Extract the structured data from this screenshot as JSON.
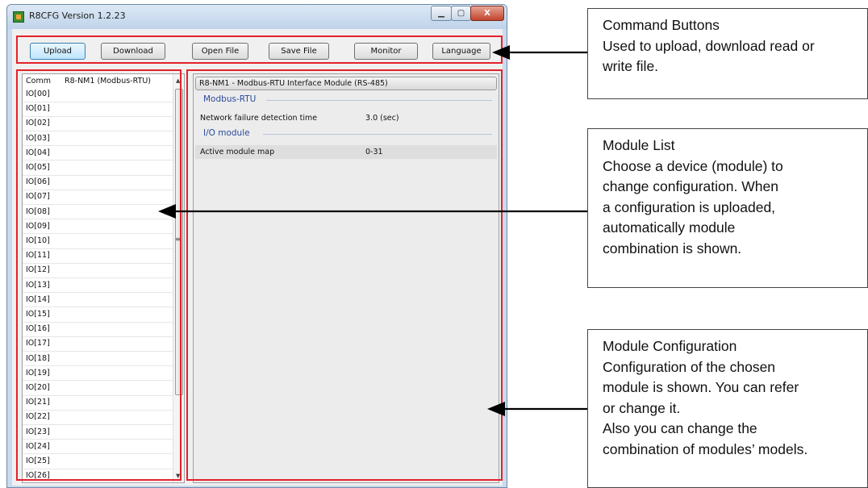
{
  "window": {
    "title": "R8CFG Version 1.2.23",
    "min_glyph": "▁",
    "max_glyph": "▢",
    "close_glyph": "X"
  },
  "toolbar": {
    "upload": "Upload",
    "download": "Download",
    "open_file": "Open File",
    "save_file": "Save File",
    "monitor": "Monitor",
    "language": "Language"
  },
  "module_list": {
    "head_slot": "Comm",
    "head_module": "R8-NM1 (Modbus-RTU)",
    "rows": [
      "IO[00]",
      "IO[01]",
      "IO[02]",
      "IO[03]",
      "IO[04]",
      "IO[05]",
      "IO[06]",
      "IO[07]",
      "IO[08]",
      "IO[09]",
      "IO[10]",
      "IO[11]",
      "IO[12]",
      "IO[13]",
      "IO[14]",
      "IO[15]",
      "IO[16]",
      "IO[17]",
      "IO[18]",
      "IO[19]",
      "IO[20]",
      "IO[21]",
      "IO[22]",
      "IO[23]",
      "IO[24]",
      "IO[25]",
      "IO[26]"
    ]
  },
  "config": {
    "header": "R8-NM1 - Modbus-RTU Interface Module (RS-485)",
    "group1": "Modbus-RTU",
    "prop1_name": "Network failure detection time",
    "prop1_value": "3.0 (sec)",
    "group2": "I/O module",
    "prop2_name": "Active module map",
    "prop2_value": "0-31"
  },
  "annotations": {
    "command_buttons": [
      "Command Buttons",
      "Used to upload, download read or",
      "write file."
    ],
    "module_list": [
      "Module List",
      "Choose a device (module) to",
      "change configuration. When",
      "a configuration is uploaded,",
      "automatically module",
      "combination is shown."
    ],
    "module_config": [
      "Module Configuration",
      "Configuration of the chosen",
      "module is shown. You can refer",
      "or change it.",
      "Also you can change the",
      "combination of modules’ models."
    ]
  },
  "colors": {
    "highlight": "#e3222b",
    "group_text": "#2a4a9c"
  }
}
